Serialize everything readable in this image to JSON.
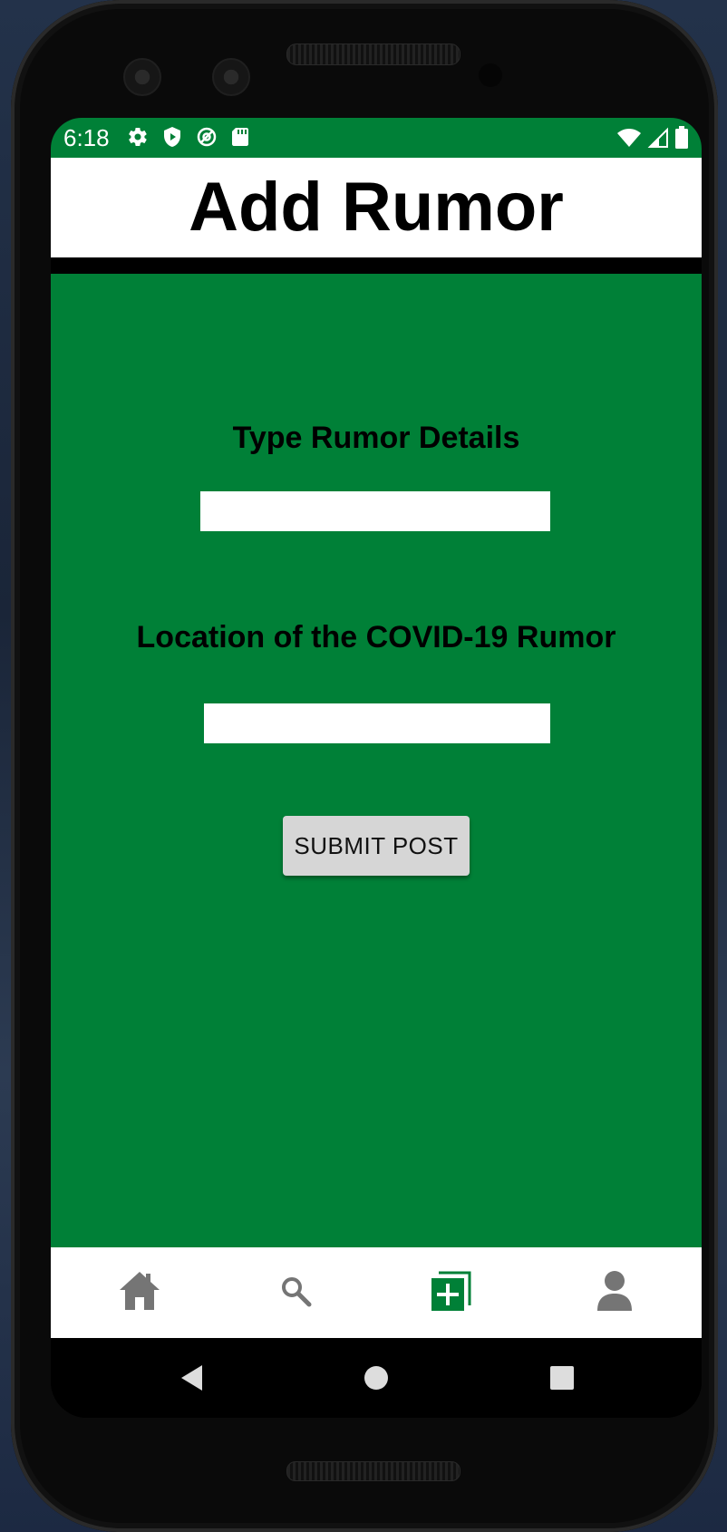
{
  "status_bar": {
    "time": "6:18",
    "left_icons": [
      "gear-icon",
      "shield-play-icon",
      "at-sync-icon",
      "sd-card-icon"
    ],
    "right_icons": [
      "wifi-icon",
      "cell-signal-icon",
      "battery-icon"
    ]
  },
  "header": {
    "title": "Add Rumor"
  },
  "form": {
    "details_label": "Type Rumor Details",
    "details_value": "",
    "location_label": "Location of the COVID-19 Rumor",
    "location_value": "",
    "submit_label": "SUBMIT POST"
  },
  "bottom_nav": {
    "items": [
      {
        "icon": "home-icon",
        "active": false
      },
      {
        "icon": "search-icon",
        "active": false
      },
      {
        "icon": "add-post-icon",
        "active": true
      },
      {
        "icon": "profile-icon",
        "active": false
      }
    ]
  },
  "system_nav": {
    "buttons": [
      "back-icon",
      "home-circle-icon",
      "recents-icon"
    ]
  },
  "colors": {
    "primary_green": "#008037",
    "nav_inactive": "#757575",
    "button_bg": "#d6d6d6"
  }
}
